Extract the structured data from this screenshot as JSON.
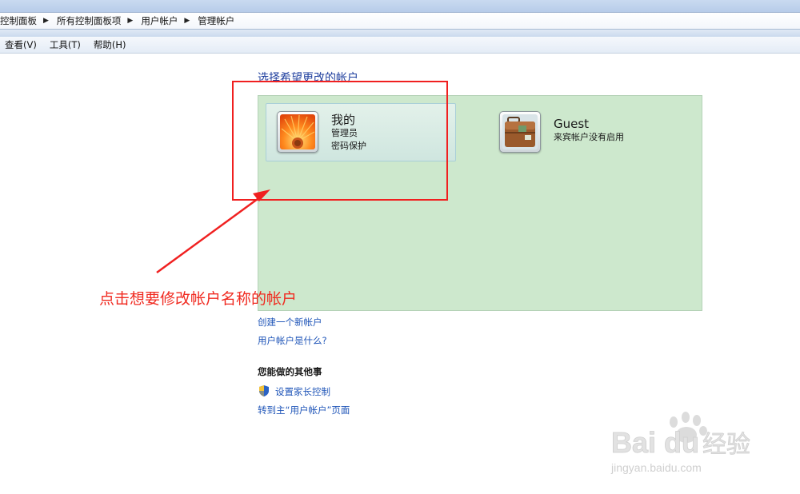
{
  "breadcrumb": {
    "items": [
      "控制面板",
      "所有控制面板项",
      "用户帐户",
      "管理帐户"
    ]
  },
  "menubar": {
    "items": [
      "查看(V)",
      "工具(T)",
      "帮助(H)"
    ]
  },
  "main": {
    "heading": "选择希望更改的帐户",
    "accounts": [
      {
        "name": "我的",
        "lines": [
          "管理员",
          "密码保护"
        ],
        "avatar": "orange-flower-avatar-icon"
      },
      {
        "name": "Guest",
        "lines": [
          "来宾帐户没有启用"
        ],
        "avatar": "suitcase-avatar-icon"
      }
    ],
    "links": {
      "create_account": "创建一个新帐户",
      "what_is_account": "用户帐户是什么?"
    },
    "other": {
      "title": "您能做的其他事",
      "parental_controls": "设置家长控制",
      "go_main": "转到主“用户帐户”页面"
    }
  },
  "annotation": {
    "text": "点击想要修改帐户名称的帐户",
    "color": "#f02a20"
  },
  "watermark": {
    "brand": "Baidu经验",
    "url": "jingyan.baidu.com"
  },
  "colors": {
    "link": "#1f55b8",
    "heading": "#1f3f9e",
    "panel": "#cde8cd",
    "highlight": "#f02020"
  }
}
